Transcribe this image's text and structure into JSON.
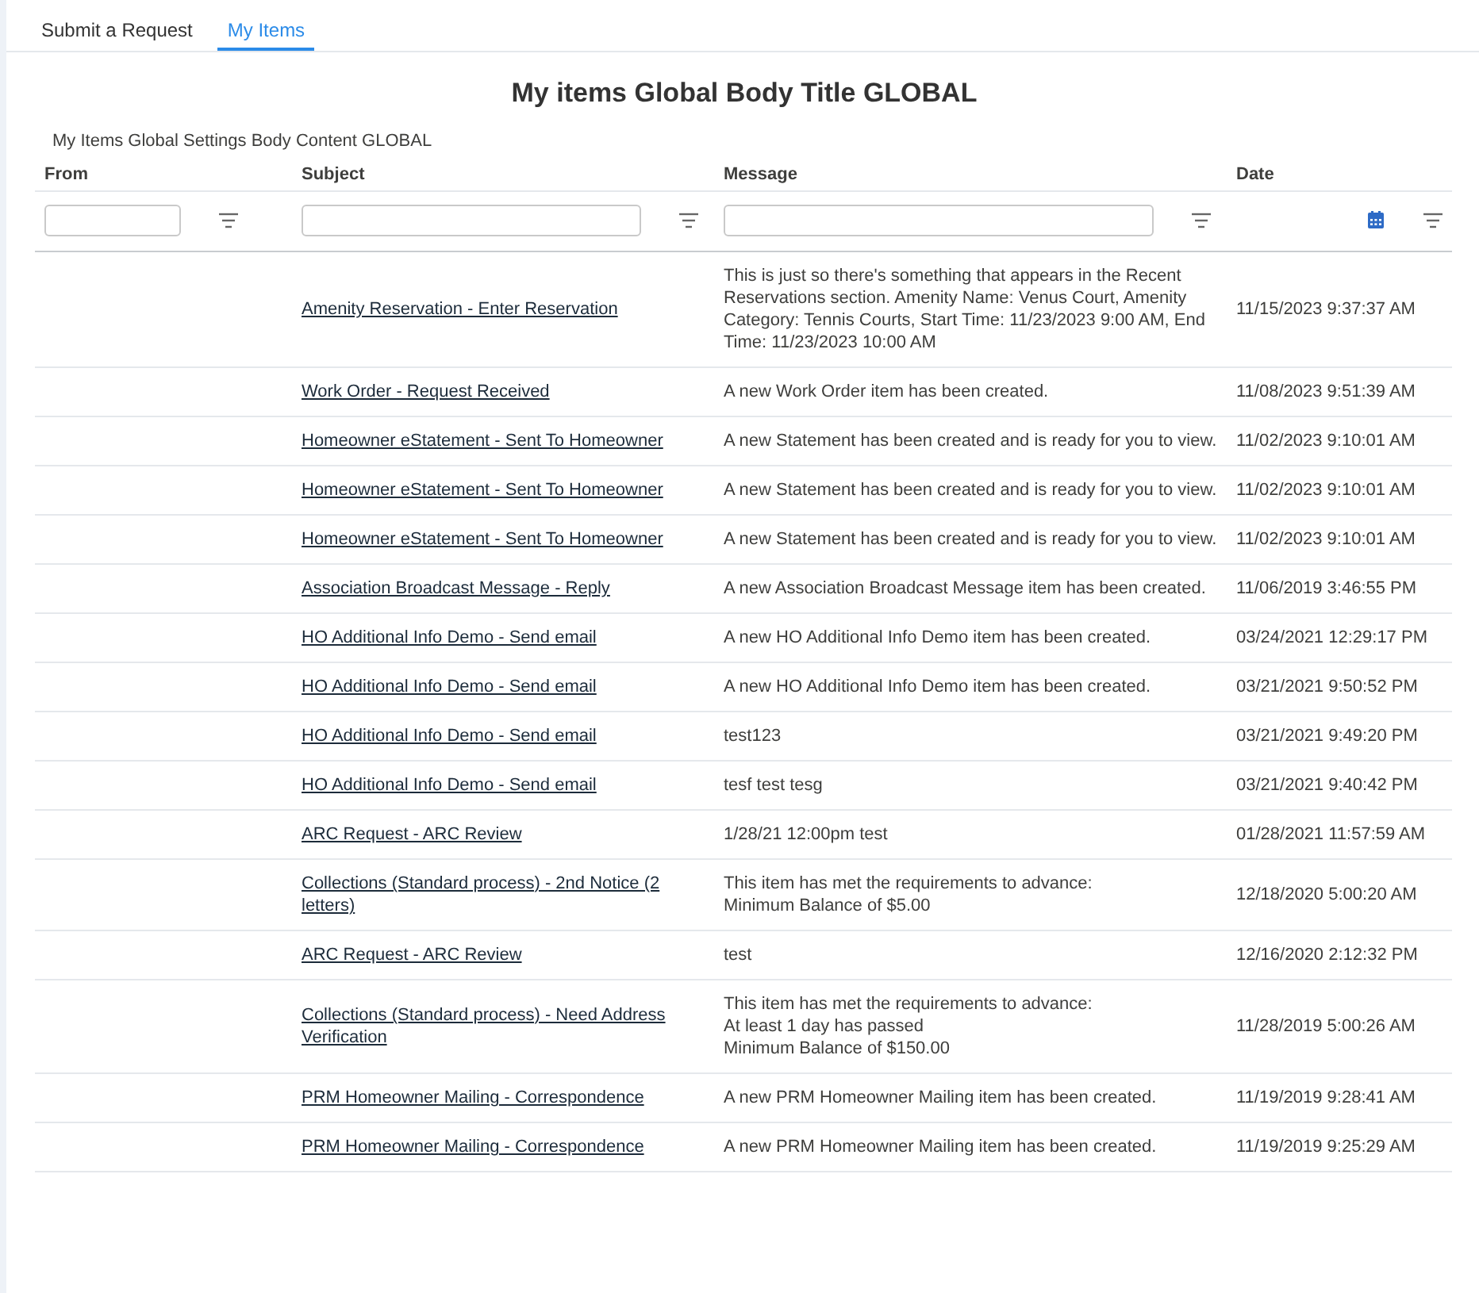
{
  "tabs": [
    {
      "label": "Submit a Request",
      "selected": false
    },
    {
      "label": "My Items",
      "selected": true
    }
  ],
  "title": "My items Global Body Title GLOBAL",
  "body_content": "My Items Global Settings Body Content  GLOBAL",
  "table": {
    "columns": [
      {
        "label": "From",
        "kind": "text"
      },
      {
        "label": "Subject",
        "kind": "text"
      },
      {
        "label": "Message",
        "kind": "text"
      },
      {
        "label": "Date",
        "kind": "date"
      }
    ],
    "rows": [
      {
        "subject": "Amenity Reservation - Enter Reservation",
        "message": "This is just so there's something that appears in the Recent Reservations section. Amenity Name: Venus Court, Amenity Category: Tennis Courts, Start Time: 11/23/2023 9:00 AM, End Time: 11/23/2023 10:00 AM",
        "date": "11/15/2023 9:37:37 AM"
      },
      {
        "subject": "Work Order - Request Received",
        "message": "A new Work Order item has been created.",
        "date": "11/08/2023 9:51:39 AM"
      },
      {
        "subject": "Homeowner eStatement - Sent To Homeowner",
        "message": "A new Statement has been created and is ready for you to view.",
        "date": "11/02/2023 9:10:01 AM"
      },
      {
        "subject": "Homeowner eStatement - Sent To Homeowner",
        "message": "A new Statement has been created and is ready for you to view.",
        "date": "11/02/2023 9:10:01 AM"
      },
      {
        "subject": "Homeowner eStatement - Sent To Homeowner",
        "message": "A new Statement has been created and is ready for you to view.",
        "date": "11/02/2023 9:10:01 AM"
      },
      {
        "subject": "Association Broadcast Message - Reply",
        "message": "A new Association Broadcast Message item has been created.",
        "date": "11/06/2019 3:46:55 PM"
      },
      {
        "subject": "HO Additional Info Demo - Send email",
        "message": "A new HO Additional Info Demo item has been created.",
        "date": "03/24/2021 12:29:17 PM"
      },
      {
        "subject": "HO Additional Info Demo - Send email",
        "message": "A new HO Additional Info Demo item has been created.",
        "date": "03/21/2021 9:50:52 PM"
      },
      {
        "subject": "HO Additional Info Demo - Send email",
        "message": "test123",
        "date": "03/21/2021 9:49:20 PM"
      },
      {
        "subject": "HO Additional Info Demo - Send email",
        "message": "tesf test tesg",
        "date": "03/21/2021 9:40:42 PM"
      },
      {
        "subject": "ARC Request - ARC Review",
        "message": "1/28/21 12:00pm test",
        "date": "01/28/2021 11:57:59 AM"
      },
      {
        "subject": "Collections (Standard process) - 2nd Notice (2 letters)",
        "message": "This item has met the requirements to advance:\nMinimum Balance of $5.00",
        "date": "12/18/2020 5:00:20 AM"
      },
      {
        "subject": "ARC Request - ARC Review",
        "message": "test",
        "date": "12/16/2020 2:12:32 PM"
      },
      {
        "subject": "Collections (Standard process) - Need Address Verification",
        "message": "This item has met the requirements to advance:\nAt least 1 day has passed\nMinimum Balance of $150.00",
        "date": "11/28/2019 5:00:26 AM"
      },
      {
        "subject": "PRM Homeowner Mailing - Correspondence",
        "message": "A new PRM Homeowner Mailing item has been created.",
        "date": "11/19/2019 9:28:41 AM"
      },
      {
        "subject": "PRM Homeowner Mailing - Correspondence",
        "message": "A new PRM Homeowner Mailing item has been created.",
        "date": "11/19/2019 9:25:29 AM"
      }
    ]
  }
}
